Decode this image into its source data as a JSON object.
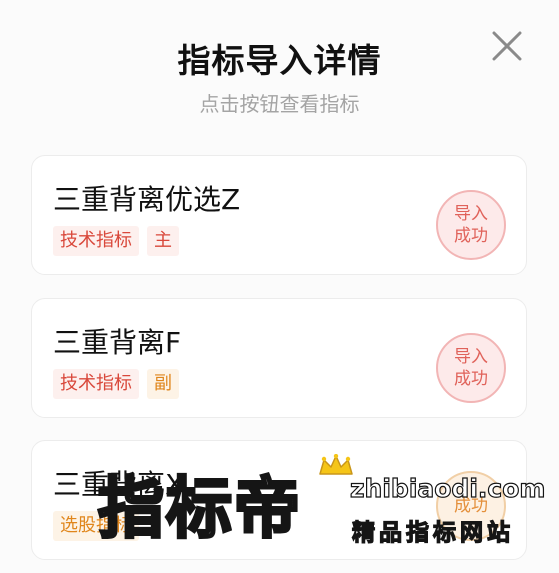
{
  "dialog": {
    "title": "指标导入详情",
    "subtitle": "点击按钮查看指标",
    "close_icon": "close-icon"
  },
  "indicators": [
    {
      "name": "三重背离优选Z",
      "tags": [
        {
          "label": "技术指标",
          "color": "#d9483b"
        },
        {
          "label": "主",
          "color": "#d9483b"
        }
      ],
      "status": "导入\n成功",
      "status_color": "#e0625a"
    },
    {
      "name": "三重背离F",
      "tags": [
        {
          "label": "技术指标",
          "color": "#d9483b"
        },
        {
          "label": "副",
          "color": "#e0861c"
        }
      ],
      "status": "导入\n成功",
      "status_color": "#e0625a"
    },
    {
      "name": "三重背离X",
      "tags": [
        {
          "label": "选股指标",
          "color": "#e0861c"
        }
      ],
      "status": "成功",
      "status_color": "#e48f3a"
    }
  ],
  "watermark": {
    "big": "指标帝",
    "url": "zhibiaodi.com",
    "sub": "精品指标网站",
    "crown_icon": "crown-icon"
  }
}
